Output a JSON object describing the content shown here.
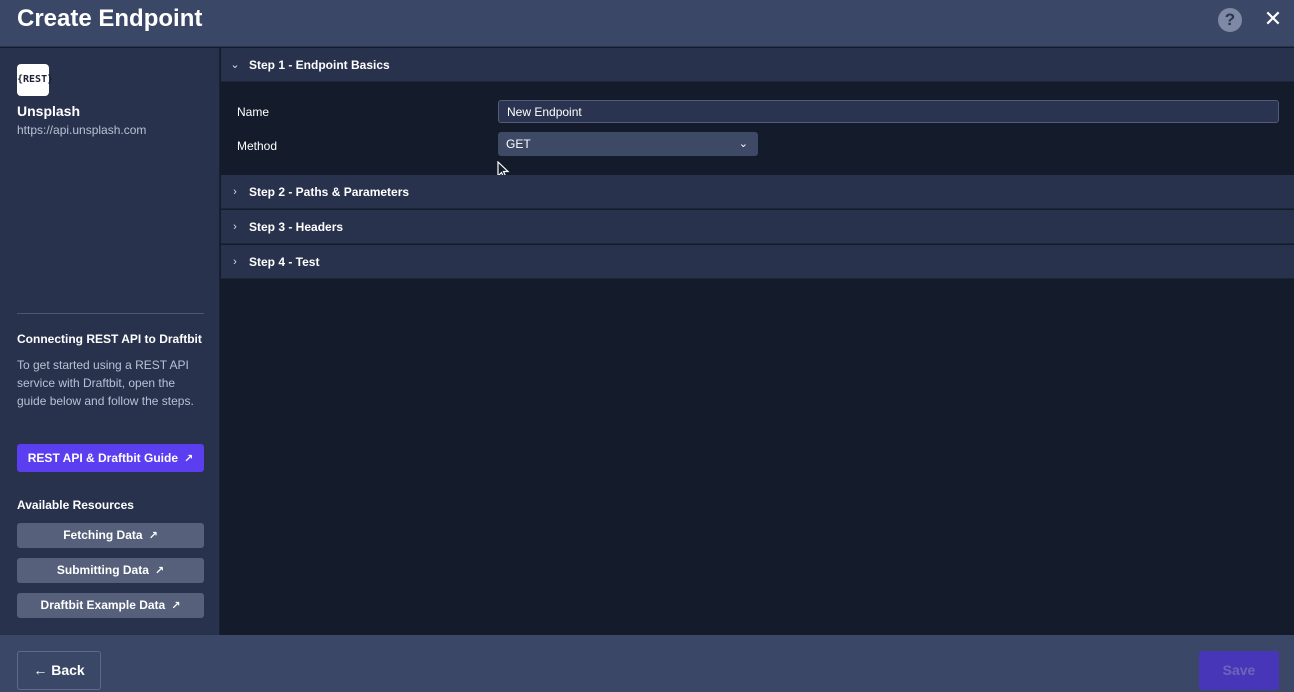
{
  "header": {
    "title": "Create Endpoint",
    "help_symbol": "?",
    "close_symbol": "✕"
  },
  "sidebar": {
    "logo_text": "{REST}",
    "api_name": "Unsplash",
    "api_url": "https://api.unsplash.com",
    "intro_heading": "Connecting REST API to Draftbit",
    "intro_text": "To get started using a REST API service with Draftbit, open the guide below and follow the steps.",
    "guide_button": "REST API & Draftbit Guide",
    "resources_heading": "Available Resources",
    "resources": [
      {
        "label": "Fetching Data"
      },
      {
        "label": "Submitting Data"
      },
      {
        "label": "Draftbit Example Data"
      }
    ]
  },
  "steps": [
    {
      "label": "Step 1 - Endpoint Basics",
      "expanded": true,
      "chevron": "⌄"
    },
    {
      "label": "Step 2 - Paths & Parameters",
      "expanded": false,
      "chevron": "›"
    },
    {
      "label": "Step 3 - Headers",
      "expanded": false,
      "chevron": "›"
    },
    {
      "label": "Step 4 - Test",
      "expanded": false,
      "chevron": "›"
    }
  ],
  "form": {
    "name_label": "Name",
    "name_value": "New Endpoint",
    "method_label": "Method",
    "method_value": "GET"
  },
  "footer": {
    "back_label": "← Back",
    "save_label": "Save"
  },
  "colors": {
    "accent": "#5a3ef0",
    "header_bg": "#3b4766",
    "sidebar_bg": "#28324c",
    "main_bg": "#141b2b"
  }
}
